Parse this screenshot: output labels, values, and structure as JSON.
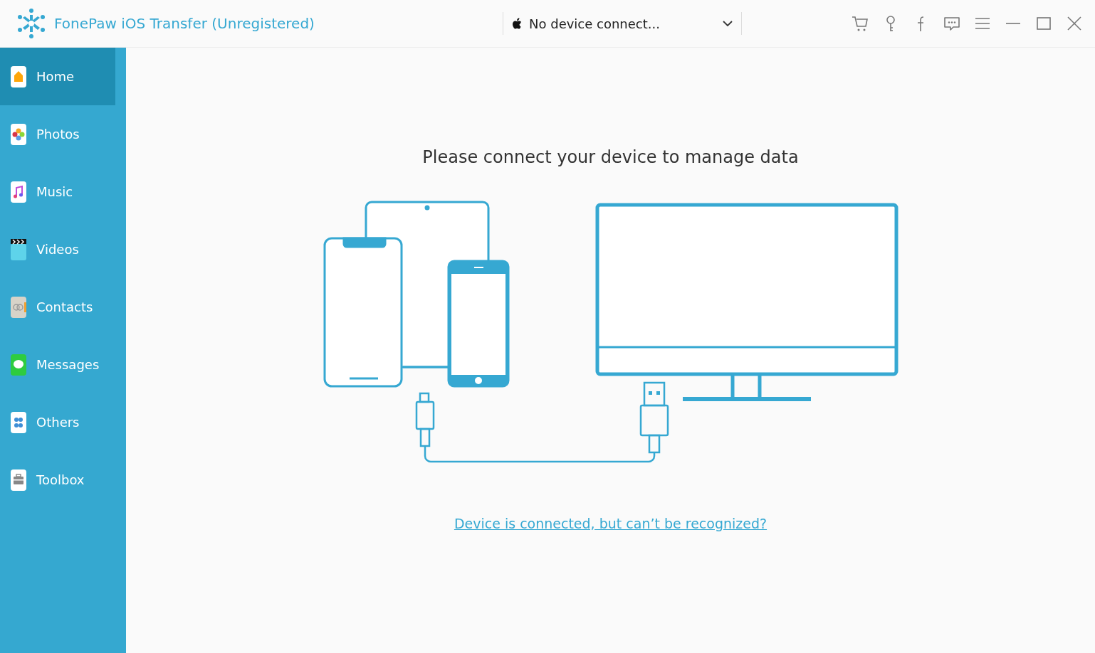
{
  "window": {
    "title": "FonePaw iOS Transfer (Unregistered)"
  },
  "device_selector": {
    "value": "No device connect..."
  },
  "sidebar": {
    "items": [
      {
        "label": "Home",
        "selected": true
      },
      {
        "label": "Photos",
        "selected": false
      },
      {
        "label": "Music",
        "selected": false
      },
      {
        "label": "Videos",
        "selected": false
      },
      {
        "label": "Contacts",
        "selected": false
      },
      {
        "label": "Messages",
        "selected": false
      },
      {
        "label": "Others",
        "selected": false
      },
      {
        "label": "Toolbox",
        "selected": false
      }
    ]
  },
  "main": {
    "heading": "Please connect your device to manage data",
    "help_link": "Device is connected, but can’t be recognized?"
  }
}
